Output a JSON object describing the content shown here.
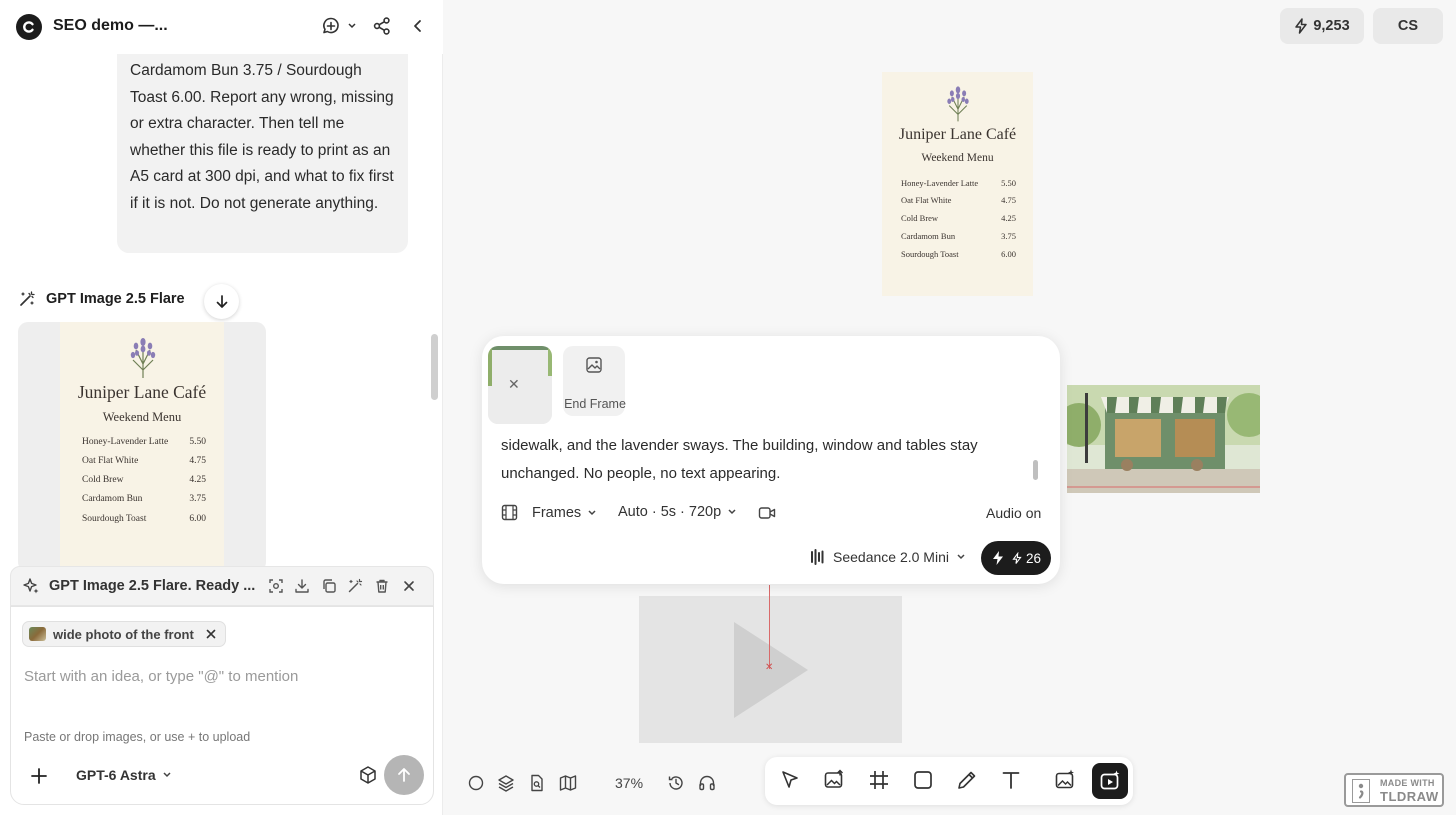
{
  "header": {
    "title": "SEO demo —..."
  },
  "chat": {
    "user_message": "Cardamom Bun 3.75 / Sourdough Toast 6.00. Report any wrong, missing or extra character. Then tell me whether this file is ready to print as an A5 card at 300 dpi, and what to fix first if it is not. Do not generate anything.",
    "model_name": "GPT Image 2.5 Flare"
  },
  "menu_card": {
    "title": "Juniper Lane Café",
    "subtitle": "Weekend Menu",
    "items": [
      {
        "name": "Honey-Lavender Latte",
        "price": "5.50"
      },
      {
        "name": "Oat Flat White",
        "price": "4.75"
      },
      {
        "name": "Cold Brew",
        "price": "4.25"
      },
      {
        "name": "Cardamom Bun",
        "price": "3.75"
      },
      {
        "name": "Sourdough Toast",
        "price": "6.00"
      }
    ]
  },
  "generation": {
    "label": "GPT Image 2.5 Flare. Ready ..."
  },
  "composer": {
    "chip_label": "wide photo of the front",
    "placeholder": "Start with an idea, or type \"@\" to mention",
    "hint": "Paste or drop images, or use + to upload",
    "model": "GPT-6 Astra"
  },
  "canvas": {
    "credits": "9,253",
    "avatar": "CS",
    "zoom": "37%",
    "watermark_line1": "MADE WITH",
    "watermark_line2": "TLDRAW"
  },
  "video_panel": {
    "end_frame_label": "End Frame",
    "prompt_text": "sidewalk, and the lavender sways. The building, window and tables stay unchanged. No people, no text appearing.",
    "frames_label": "Frames",
    "settings_label": "Auto · 5s · 720p",
    "audio_label": "Audio on",
    "model_label": "Seedance 2.0 Mini",
    "cost": "26"
  },
  "icons": {
    "logo": "logo-c-icon",
    "new_chat": "chat-plus-icon",
    "share": "share-icon",
    "collapse": "chevron-left-icon",
    "model": "magic-wand-icon",
    "scroll_down": "arrow-down-icon",
    "credits": "lightning-icon"
  }
}
